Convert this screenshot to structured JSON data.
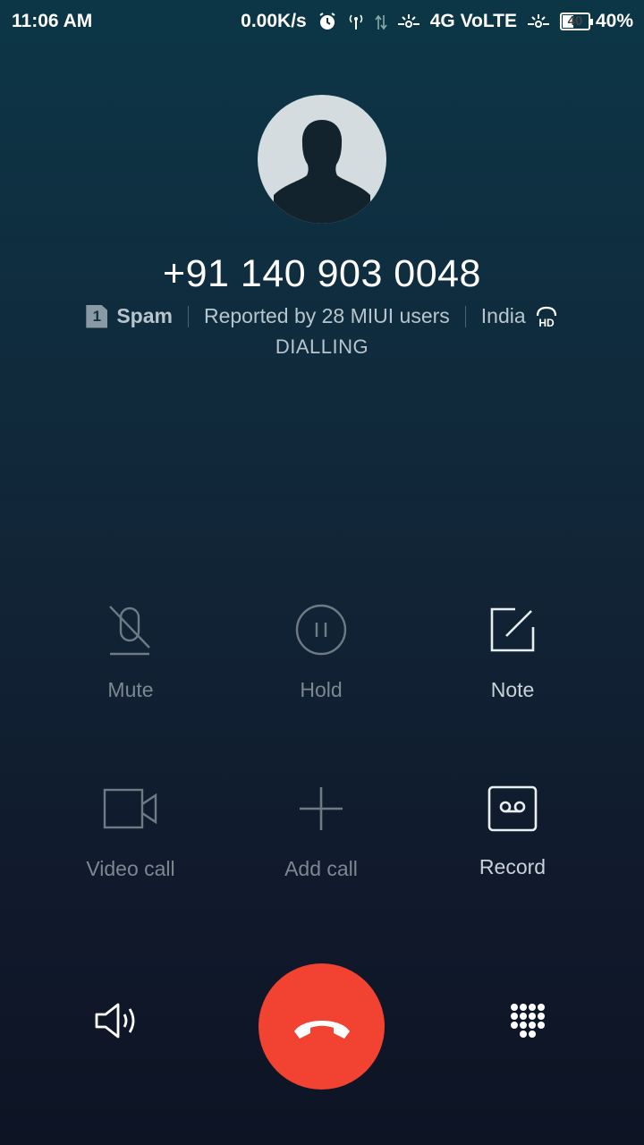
{
  "status_bar": {
    "time": "11:06 AM",
    "speed": "0.00K/s",
    "network": "4G VoLTE",
    "battery_level": "40",
    "battery_percent": "40%",
    "icons": [
      "alarm-icon",
      "hotspot-icon",
      "data-arrows-icon",
      "signal-icon",
      "signal-icon"
    ]
  },
  "caller": {
    "number": "+91 140 903 0048",
    "sim_slot": "1",
    "tag": "Spam",
    "report": "Reported by 28 MIUI users",
    "location": "India",
    "hd_label": "HD",
    "call_status": "DIALLING"
  },
  "controls": {
    "mute": "Mute",
    "hold": "Hold",
    "note": "Note",
    "video_call": "Video call",
    "add_call": "Add call",
    "record": "Record"
  },
  "colors": {
    "end_call": "#f24232",
    "dim_text": "#7c8790",
    "active_text": "#c9d2d8"
  }
}
